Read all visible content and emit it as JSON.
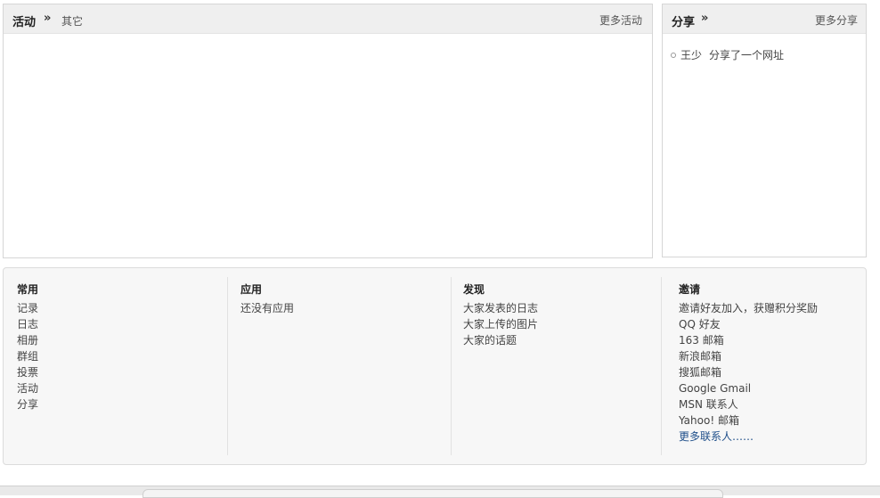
{
  "activity": {
    "title": "活动",
    "chevron": "»",
    "other_tab": "其它",
    "more": "更多活动"
  },
  "share": {
    "title": "分享",
    "chevron": "»",
    "more": "更多分享",
    "items": [
      {
        "user": "王少",
        "action": "分享了一个网址"
      }
    ]
  },
  "footer": {
    "common": {
      "title": "常用",
      "items": [
        "记录",
        "日志",
        "相册",
        "群组",
        "投票",
        "活动",
        "分享"
      ]
    },
    "apps": {
      "title": "应用",
      "note": "还没有应用"
    },
    "discover": {
      "title": "发现",
      "items": [
        "大家发表的日志",
        "大家上传的图片",
        "大家的话题"
      ]
    },
    "invite": {
      "title": "邀请",
      "items": [
        "邀请好友加入，获赠积分奖励",
        "QQ 好友",
        "163 邮箱",
        "新浪邮箱",
        "搜狐邮箱",
        "Google Gmail",
        "MSN 联系人",
        "Yahoo! 邮箱"
      ],
      "more": "更多联系人……"
    }
  },
  "colors": {
    "header_bg": "#efefef",
    "footer_bg": "#f7f7f7",
    "link_blue": "#1f4f8a"
  }
}
